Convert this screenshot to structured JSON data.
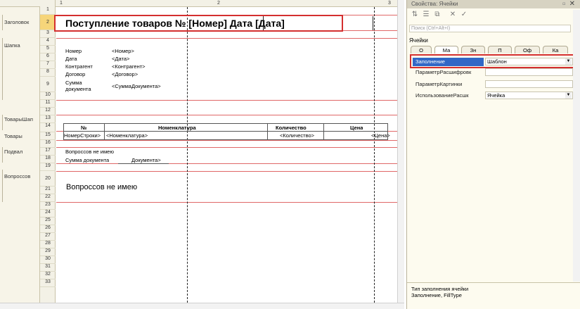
{
  "row_groups": [
    {
      "label": "Заголовок"
    },
    {
      "label": "Шапка"
    },
    {
      "label": "ТоварыШап"
    },
    {
      "label": "Товары"
    },
    {
      "label": "Подвал"
    },
    {
      "label": "Вопроссов"
    }
  ],
  "row_numbers": [
    "1",
    "2",
    "3",
    "4",
    "5",
    "6",
    "7",
    "8",
    "9",
    "10",
    "11",
    "12",
    "13",
    "14",
    "15",
    "16",
    "17",
    "18",
    "19",
    "20",
    "21",
    "22",
    "23",
    "24",
    "25",
    "26",
    "27",
    "28",
    "29",
    "30",
    "31",
    "32",
    "33"
  ],
  "columns": [
    "1",
    "2",
    "3"
  ],
  "title_cell": "Поступление товаров № [Номер] Дата [Дата]",
  "header_fields": [
    {
      "label": "Номер",
      "value": "<Номер>"
    },
    {
      "label": "Дата",
      "value": "<Дата>"
    },
    {
      "label": "Контрагент",
      "value": "<Контрагент>"
    },
    {
      "label": "Договор",
      "value": "<Договор>"
    },
    {
      "label": "Сумма документа",
      "value": "<СуммаДокумента>"
    }
  ],
  "table_headers": [
    "№",
    "Номенклатура",
    "Количество",
    "Цена"
  ],
  "table_row": [
    "НомерСтроки>",
    "<Номенклатура>",
    "<Количество>",
    "<Цена>"
  ],
  "footer": {
    "line1": "Вопроссов не имею",
    "line2_label": "Сумма документа",
    "line2_value": "Документа>"
  },
  "question_cell": "Вопроссов не имею",
  "properties": {
    "title": "Свойства: Ячейки",
    "search_placeholder": "Поиск (Ctrl+Alt+I)",
    "object": "Ячейки",
    "tabs": [
      "О",
      "Ма",
      "Зн",
      "П",
      "Оф",
      "Ка"
    ],
    "rows": [
      {
        "name": "Заполнение",
        "value": "Шаблон"
      },
      {
        "name": "ПараметрРасшифровк",
        "value": ""
      },
      {
        "name": "ПараметрКартинки",
        "value": ""
      },
      {
        "name": "ИспользованиеРасшк",
        "value": "Ячейка"
      }
    ],
    "description_line1": "Тип заполнения ячейки",
    "description_line2": "Заполнение, FillType"
  },
  "colors": {
    "highlight": "#d42f2f",
    "selected_row": "#3167c6",
    "section_line": "#e06767"
  }
}
